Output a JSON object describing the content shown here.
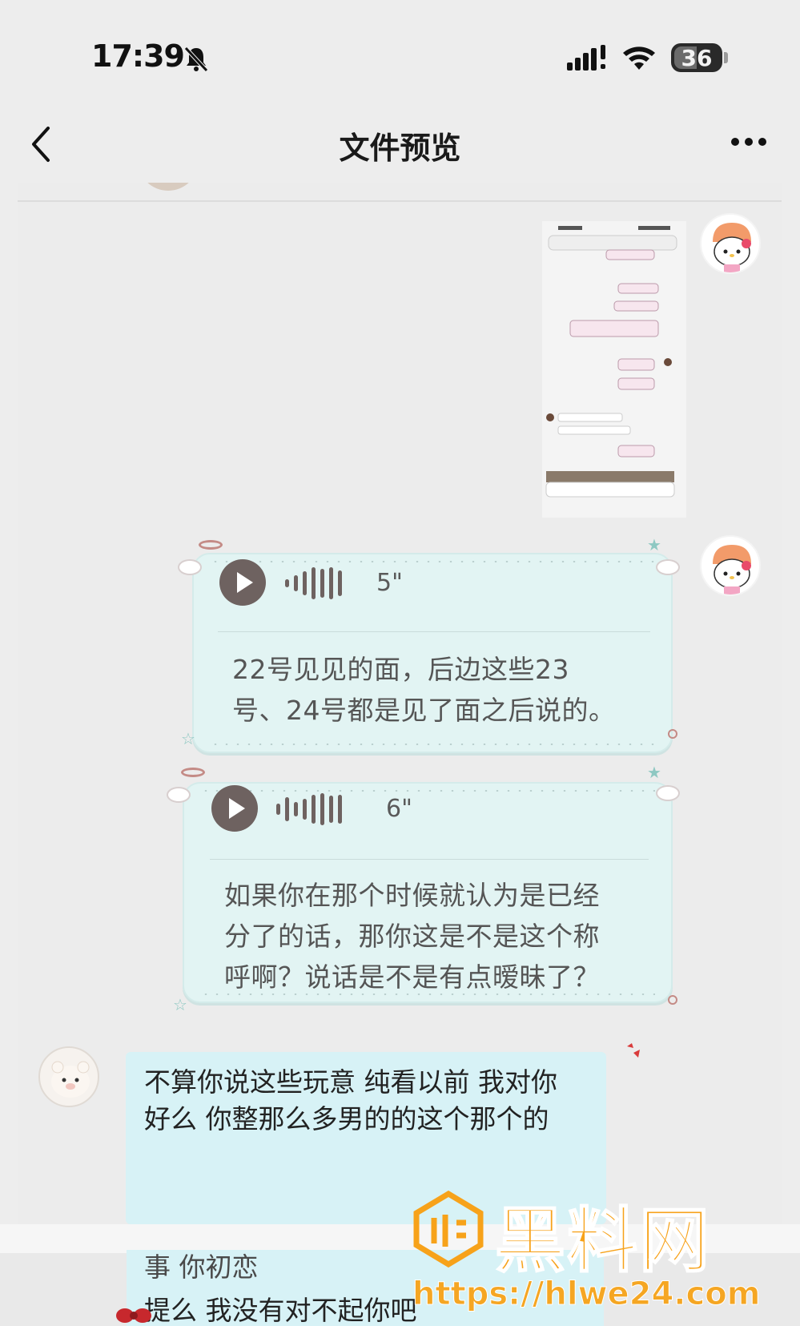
{
  "status_bar": {
    "time": "17:39",
    "battery": "36",
    "icons": [
      "mute-bell-icon",
      "cellular-signal-icon",
      "wifi-icon",
      "battery-icon"
    ]
  },
  "nav": {
    "title": "文件预览",
    "back_icon": "chevron-left-icon",
    "more_icon": "ellipsis-icon"
  },
  "messages": [
    {
      "type": "image",
      "sender": "self",
      "content": "chat-screenshot-thumbnail"
    },
    {
      "type": "voice",
      "sender": "self",
      "duration": "5\"",
      "transcript_lines": [
        "22号见见的面，后边这些23",
        "号、24号都是见了面之后说的。"
      ]
    },
    {
      "type": "voice",
      "sender": "self",
      "duration": "6\"",
      "transcript_lines": [
        "如果你在那个时候就认为是已经",
        "分了的话，那你这是不是这个称",
        "呼啊？说话是不是有点暧昧了？"
      ]
    },
    {
      "type": "text",
      "sender": "other",
      "lines": [
        "不算你说这些玩意 纯看以前 我对你",
        "好么 你整那么多男的的这个那个的"
      ]
    }
  ],
  "lower_slice": {
    "lines": [
      "事 你初恋",
      "提么 我没有对不起你吧"
    ]
  },
  "watermark": {
    "brand": "黑料网",
    "url": "https://hlwe24.com"
  },
  "colors": {
    "background": "#ededed",
    "voice_bubble": "#e2f4f3",
    "text_bubble": "#d7f2f6",
    "play_button": "#6e6260",
    "watermark": "#f7a21a"
  }
}
